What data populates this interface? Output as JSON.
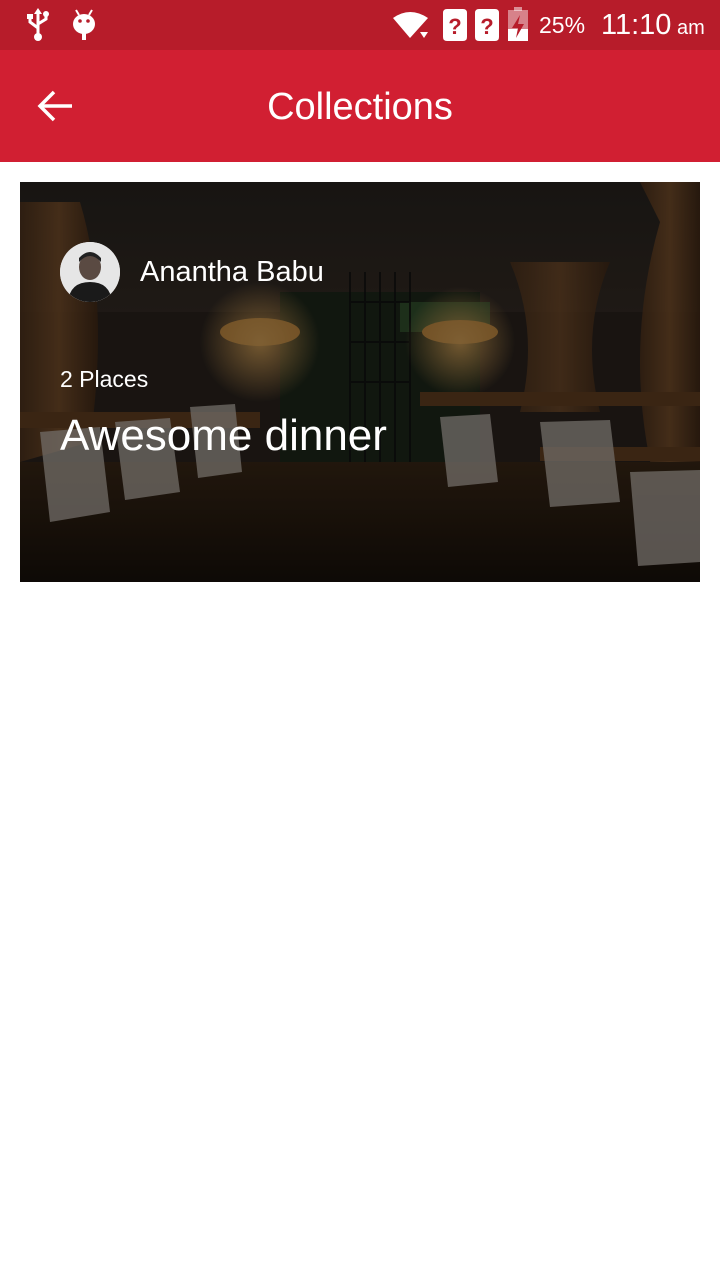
{
  "status_bar": {
    "battery": "25%",
    "time": "11:10",
    "ampm": "am",
    "icons": [
      "usb-icon",
      "android-debug-icon",
      "wifi-icon",
      "sim1-unknown-icon",
      "sim2-unknown-icon",
      "battery-charging-icon"
    ]
  },
  "app_bar": {
    "title": "Collections",
    "back_icon": "arrow-back-icon",
    "color": "#d11f32"
  },
  "collections": [
    {
      "owner": "Anantha Babu",
      "places": "2 Places",
      "title": "Awesome dinner"
    }
  ]
}
